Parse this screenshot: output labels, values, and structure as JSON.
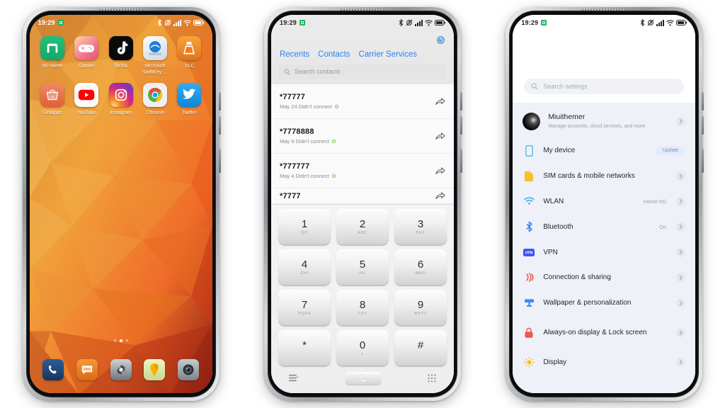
{
  "statusbar": {
    "time": "19:29",
    "icons": [
      "bluetooth-icon",
      "vibrate-off-icon",
      "signal-icon",
      "wifi-icon",
      "battery-icon"
    ]
  },
  "home": {
    "rows": [
      [
        {
          "label": "Mi Home",
          "icon": "mi-home-icon",
          "bg": "#1fb574"
        },
        {
          "label": "Games",
          "icon": "games-icon",
          "bg": "#f08a9c"
        },
        {
          "label": "TikTok",
          "icon": "tiktok-icon",
          "bg": "#0b0b0b"
        },
        {
          "label": "Microsoft SwiftKey …",
          "icon": "swiftkey-icon",
          "bg": "#e9eef3"
        },
        {
          "label": "VLC",
          "icon": "vlc-icon",
          "bg": "#ef8b26"
        }
      ],
      [
        {
          "label": "GetApps",
          "icon": "getapps-icon",
          "bg": "#e96a4e"
        },
        {
          "label": "YouTube",
          "icon": "youtube-icon",
          "bg": "#f4f4f4"
        },
        {
          "label": "Instagram",
          "icon": "instagram-icon",
          "bg": "#c13584"
        },
        {
          "label": "Chrome",
          "icon": "chrome-icon",
          "bg": "#f1f1f1"
        },
        {
          "label": "Twitter",
          "icon": "twitter-icon",
          "bg": "#1d9bf0"
        }
      ]
    ],
    "dock": [
      {
        "label": "Phone",
        "icon": "phone-icon",
        "bg": "#1b3a64"
      },
      {
        "label": "Messaging",
        "icon": "sms-icon",
        "bg": "#e07b22"
      },
      {
        "label": "Settings",
        "icon": "gear-icon",
        "bg": "#8e9196"
      },
      {
        "label": "Maps",
        "icon": "maps-icon",
        "bg": "#dfe6b4"
      },
      {
        "label": "Camera",
        "icon": "camera-icon",
        "bg": "#9aa2ab"
      }
    ],
    "page_dots": {
      "count": 3,
      "active_index": 1
    }
  },
  "dialer": {
    "settings_icon": "dialer-settings-icon",
    "tabs": [
      {
        "label": "Recents"
      },
      {
        "label": "Contacts"
      },
      {
        "label": "Carrier Services"
      }
    ],
    "search": {
      "placeholder": "Search contacts",
      "icon": "search-icon"
    },
    "calls": [
      {
        "number": "*77777",
        "detail": "May 24 Didn't connect"
      },
      {
        "number": "*7778888",
        "detail": "May 9 Didn't connect"
      },
      {
        "number": "*777777",
        "detail": "May 4 Didn't connect"
      },
      {
        "number": "*7777",
        "detail": ""
      }
    ],
    "keys": [
      {
        "digit": "1",
        "letters": "QO"
      },
      {
        "digit": "2",
        "letters": "ABC"
      },
      {
        "digit": "3",
        "letters": "DEF"
      },
      {
        "digit": "4",
        "letters": "GHI"
      },
      {
        "digit": "5",
        "letters": "JKL"
      },
      {
        "digit": "6",
        "letters": "MNO"
      },
      {
        "digit": "7",
        "letters": "PQRS"
      },
      {
        "digit": "8",
        "letters": "TUV"
      },
      {
        "digit": "9",
        "letters": "WXYZ"
      },
      {
        "digit": "*",
        "letters": ","
      },
      {
        "digit": "0",
        "letters": "+"
      },
      {
        "digit": "#",
        "letters": ""
      }
    ],
    "actions": [
      {
        "name": "call-log-button",
        "icon": "list-icon"
      },
      {
        "name": "call-button",
        "icon": "handset-icon"
      },
      {
        "name": "keypad-button",
        "icon": "dialpad-icon"
      }
    ]
  },
  "settings": {
    "search": {
      "placeholder": "Search settings",
      "icon": "search-icon"
    },
    "rows": [
      {
        "title": "Miuithemer",
        "sub": "Manage accounts, cloud services, and more",
        "value": "",
        "icon": "account-avatar",
        "chevron": true
      },
      {
        "title": "My device",
        "sub": "",
        "value": "",
        "badge": "Update",
        "icon": "device-icon",
        "chevron": false
      },
      {
        "title": "SIM cards & mobile networks",
        "sub": "",
        "value": "",
        "icon": "sim-icon",
        "chevron": true
      },
      {
        "title": "WLAN",
        "sub": "",
        "value": "Home-5G",
        "icon": "wifi-icon",
        "chevron": true
      },
      {
        "title": "Bluetooth",
        "sub": "",
        "value": "On",
        "icon": "bluetooth-icon",
        "chevron": true
      },
      {
        "title": "VPN",
        "sub": "",
        "value": "",
        "icon": "vpn-icon",
        "chevron": true
      },
      {
        "title": "Connection & sharing",
        "sub": "",
        "value": "",
        "icon": "sharing-icon",
        "chevron": true
      },
      {
        "title": "Wallpaper & personalization",
        "sub": "",
        "value": "",
        "icon": "wallpaper-icon",
        "chevron": true
      },
      {
        "title": "Always-on display & Lock screen",
        "sub": "",
        "value": "",
        "icon": "lock-icon",
        "chevron": true
      },
      {
        "title": "Display",
        "sub": "",
        "value": "",
        "icon": "display-icon",
        "chevron": true
      }
    ]
  },
  "colors": {
    "accent_blue": "#2f80ed",
    "settings_bg": "#eef1f8",
    "wallpaper_warm": "#f2a03c",
    "wallpaper_deep": "#b3261a"
  }
}
